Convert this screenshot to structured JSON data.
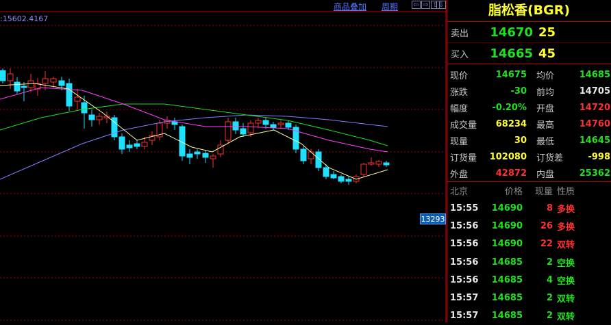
{
  "toolbar": {
    "overlay_label": "商品叠加",
    "period_label": "周期",
    "nav": [
      "⇦",
      "⇨",
      "⇧",
      "⇩"
    ]
  },
  "chart": {
    "ma_readout": ":15602.4167",
    "price_tag": "13293"
  },
  "colors": {
    "up": "#ff3030",
    "down": "#20e0ff",
    "ma5": "#ffffa0",
    "ma10": "#ff40ff",
    "ma20": "#20e020",
    "ma60": "#8080ff",
    "grid": "#a00000"
  },
  "panel": {
    "title": "脂松香(BGR)",
    "ask": {
      "label": "卖出",
      "price": "14670",
      "volume": "25"
    },
    "bid": {
      "label": "买入",
      "price": "14665",
      "volume": "45"
    },
    "stats": [
      {
        "l1": "现价",
        "v1": "14675",
        "c1": "g",
        "l2": "均价",
        "v2": "14685",
        "c2": "g"
      },
      {
        "l1": "涨跌",
        "v1": "-30",
        "c1": "g",
        "l2": "前均",
        "v2": "14705",
        "c2": "w"
      },
      {
        "l1": "幅度",
        "v1": "-0.20%",
        "c1": "g",
        "l2": "开盘",
        "v2": "14720",
        "c2": "r"
      },
      {
        "l1": "成交量",
        "v1": "68234",
        "c1": "y",
        "l2": "最高",
        "v2": "14760",
        "c2": "r"
      },
      {
        "l1": "现量",
        "v1": "30",
        "c1": "y",
        "l2": "最低",
        "v2": "14645",
        "c2": "g"
      },
      {
        "l1": "订货量",
        "v1": "102080",
        "c1": "y",
        "l2": "订货差",
        "v2": "-998",
        "c2": "y"
      },
      {
        "l1": "外盘",
        "v1": "42872",
        "c1": "r",
        "l2": "内盘",
        "v2": "25362",
        "c2": "g"
      }
    ],
    "ticks_header": [
      "北京",
      "价格",
      "现量",
      "性质"
    ],
    "ticks": [
      {
        "time": "15:55",
        "price": "14690",
        "qty": "8",
        "qc": "r",
        "type": "多换",
        "tc": "r"
      },
      {
        "time": "15:56",
        "price": "14690",
        "qty": "26",
        "qc": "r",
        "type": "多换",
        "tc": "r"
      },
      {
        "time": "15:56",
        "price": "14690",
        "qty": "22",
        "qc": "r",
        "type": "双转",
        "tc": "r"
      },
      {
        "time": "15:56",
        "price": "14685",
        "qty": "2",
        "qc": "g",
        "type": "空换",
        "tc": "g"
      },
      {
        "time": "15:56",
        "price": "14685",
        "qty": "4",
        "qc": "g",
        "type": "空换",
        "tc": "g"
      },
      {
        "time": "15:57",
        "price": "14685",
        "qty": "2",
        "qc": "g",
        "type": "双转",
        "tc": "g"
      },
      {
        "time": "15:57",
        "price": "14685",
        "qty": "2",
        "qc": "g",
        "type": "双转",
        "tc": "g"
      }
    ]
  }
}
